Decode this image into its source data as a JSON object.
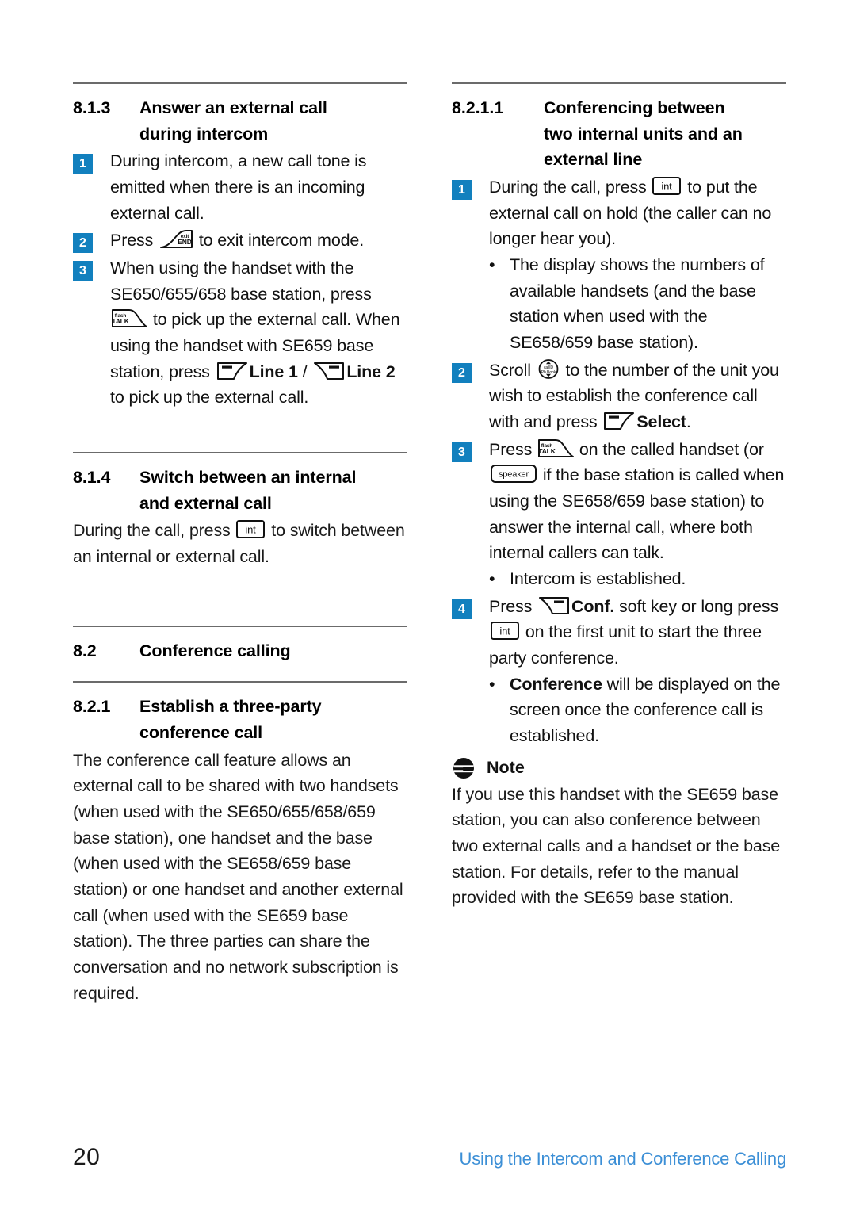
{
  "page": {
    "number": "20",
    "running_head": "Using the Intercom and Conference Calling"
  },
  "colors": {
    "step_badge": "#1280be",
    "running_head": "#3c8fd6",
    "rule": "#6b6b6b"
  },
  "icons": {
    "end_key": "end-call-key-icon",
    "end_key_label_top": "exit",
    "end_key_label_bottom": "END",
    "talk_key": "talk-key-icon",
    "talk_key_label_top": "flash",
    "talk_key_label_bottom": "TALK",
    "int_key": "int-key-icon",
    "int_key_label": "int",
    "speaker_key": "speaker-key-icon",
    "speaker_key_label": "speaker",
    "left_soft_key": "left-soft-key-icon",
    "right_soft_key": "right-soft-key-icon",
    "nav_key": "navigation-scroll-key-icon",
    "nav_key_label_top": "callID",
    "nav_key_label_bottom": "Ph.Book",
    "note_icon": "note-icon"
  },
  "left_column": {
    "section_813": {
      "number": "8.1.3",
      "title_line1": "Answer an external call",
      "title_line2": "during intercom",
      "steps": [
        {
          "n": "1",
          "text": "During intercom, a new call tone is emitted when there is an incoming external call."
        },
        {
          "n": "2",
          "pre": "Press ",
          "post": " to exit intercom mode."
        },
        {
          "n": "3",
          "p1": "When using the handset with the SE650/655/658 base station, press ",
          "p2": " to pick up the external call. When using the handset with SE659 base station, press ",
          "line1": "Line 1",
          "sep": " / ",
          "line2": "Line 2",
          "p3": " to pick up the external call."
        }
      ]
    },
    "section_814": {
      "number": "8.1.4",
      "title_line1": "Switch between an internal",
      "title_line2": "and external call",
      "pre": "During the call, press ",
      "post": " to switch between an internal or external call."
    },
    "section_82": {
      "number": "8.2",
      "title": "Conference calling"
    },
    "section_821": {
      "number": "8.2.1",
      "title_line1": "Establish a three-party",
      "title_line2": "conference call",
      "body": "The conference call feature allows an external call to be shared with two handsets (when used with the SE650/655/658/659 base station), one handset and the base (when used with the SE658/659 base station) or one handset and another external call (when used with the SE659 base station). The three parties can share the conversation and no network subscription is required."
    }
  },
  "right_column": {
    "section_8211": {
      "number": "8.2.1.1",
      "title_line1": "Conferencing between",
      "title_line2": "two internal units and an",
      "title_line3": "external line",
      "steps": [
        {
          "n": "1",
          "pre": "During the call, press ",
          "post": " to put the external call on hold (the caller can no longer hear you).",
          "bullets": [
            "The display shows the numbers of available handsets (and the base station when used with the SE658/659 base station)."
          ]
        },
        {
          "n": "2",
          "pre": "Scroll ",
          "mid": " to the number of the unit you wish to establish the conference call with and press ",
          "bold": "Select",
          "post": "."
        },
        {
          "n": "3",
          "pre": "Press ",
          "mid": " on the called handset (or ",
          "post": " if the base station is called when using the SE658/659 base station) to answer the internal call, where both internal callers can talk.",
          "bullets": [
            "Intercom is established."
          ]
        },
        {
          "n": "4",
          "pre": "Press ",
          "bold": "Conf.",
          "mid": " soft key or long press ",
          "post": " on the first unit to start the three party conference.",
          "bullets_rich": [
            {
              "bold": "Conference",
              "rest": " will be displayed on the screen once the conference call is established."
            }
          ]
        }
      ]
    },
    "note": {
      "title": "Note",
      "body": "If you use this handset with the SE659 base station, you can also conference between two external calls and a handset or the base station. For details, refer to the manual provided with the SE659 base station."
    }
  }
}
